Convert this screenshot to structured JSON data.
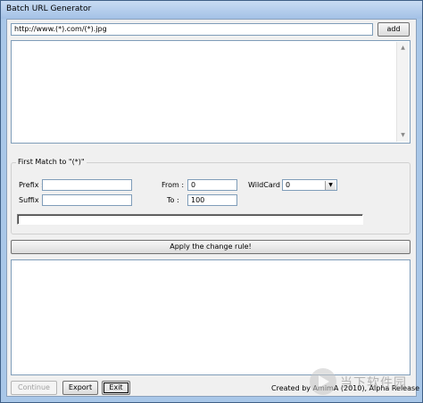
{
  "window": {
    "title": "Batch URL Generator"
  },
  "url_input": {
    "value": "http://www.(*).com/(*).jpg"
  },
  "buttons": {
    "add": "add",
    "apply": "Apply the change rule!",
    "continue": "Continue",
    "export": "Export",
    "exit": "Exit"
  },
  "group": {
    "legend": "First Match to \"(*)\"",
    "prefix_label": "Prefix :",
    "suffix_label": "Suffix :",
    "from_label": "From :",
    "to_label": "To :",
    "wildcard_label": "WildCard :",
    "prefix_value": "",
    "suffix_value": "",
    "from_value": "0",
    "to_value": "100",
    "wildcard_value": "0"
  },
  "footer": {
    "credit": "Created by AmimA (2010), Alpha Release"
  },
  "watermark": {
    "text": "当下软件园"
  }
}
